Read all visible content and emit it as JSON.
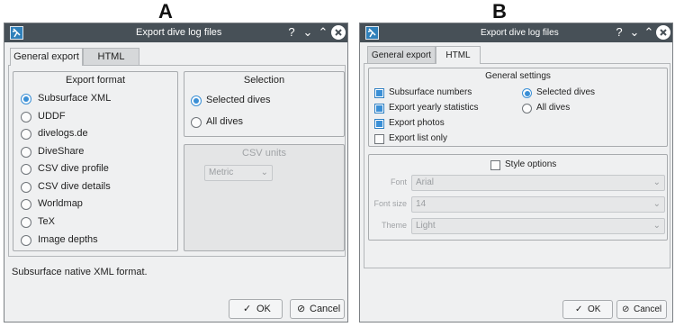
{
  "panels": {
    "a_letter": "A",
    "b_letter": "B"
  },
  "dialog_a": {
    "title": "Export dive log files",
    "titlebar_icons": {
      "help": "?",
      "minimize": "⌄",
      "maximize": "⌃"
    },
    "tabs": [
      "General export",
      "HTML"
    ],
    "export_format": {
      "title": "Export format",
      "options": [
        "Subsurface XML",
        "UDDF",
        "divelogs.de",
        "DiveShare",
        "CSV dive profile",
        "CSV dive details",
        "Worldmap",
        "TeX",
        "Image depths"
      ],
      "selected": "Subsurface XML"
    },
    "selection": {
      "title": "Selection",
      "options": [
        "Selected dives",
        "All dives"
      ],
      "selected": "Selected dives"
    },
    "csv_units": {
      "title": "CSV units",
      "value": "Metric"
    },
    "description": "Subsurface native XML format.",
    "ok_label": "OK",
    "cancel_label": "Cancel"
  },
  "dialog_b": {
    "title": "Export dive log files",
    "titlebar_icons": {
      "help": "?",
      "minimize": "⌄",
      "maximize": "⌃"
    },
    "tabs": [
      "General export",
      "HTML"
    ],
    "general_settings": {
      "title": "General settings",
      "checkboxes": [
        {
          "label": "Subsurface numbers",
          "checked": true
        },
        {
          "label": "Export yearly statistics",
          "checked": true
        },
        {
          "label": "Export photos",
          "checked": true
        },
        {
          "label": "Export list only",
          "checked": false
        }
      ],
      "radios": [
        {
          "label": "Selected dives",
          "checked": true
        },
        {
          "label": "All dives",
          "checked": false
        }
      ]
    },
    "style_options": {
      "label": "Style options",
      "checked": false,
      "font_label": "Font",
      "font_value": "Arial",
      "font_size_label": "Font size",
      "font_size_value": "14",
      "theme_label": "Theme",
      "theme_value": "Light"
    },
    "ok_label": "OK",
    "cancel_label": "Cancel"
  },
  "colors": {
    "titlebar": "#475057",
    "accent": "#3a8fd6",
    "window_bg": "#eff0f1"
  }
}
